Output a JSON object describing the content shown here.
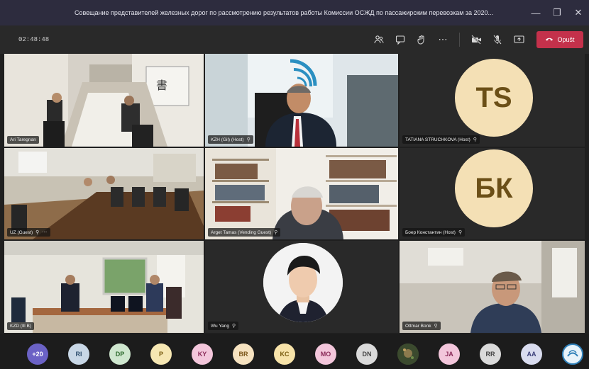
{
  "window": {
    "title": "Совещание представителей железных дорог по рассмотрению результатов работы Комиссии ОСЖД по пассажирским перевозкам за 2020..."
  },
  "toolbar": {
    "timer": "02:48:48",
    "leave_label": "Opušt",
    "icons": [
      "people-icon",
      "chat-icon",
      "raise-hand-icon",
      "more-icon",
      "camera-off-icon",
      "mic-off-icon",
      "share-screen-icon"
    ]
  },
  "tiles": [
    {
      "name": "Ari Taregnan"
    },
    {
      "name": "KZH (Gil) (Host)"
    },
    {
      "name": "TATIANA STRUCHKOVA (Host)",
      "initials": "TS"
    },
    {
      "name": "UZ (Guest)"
    },
    {
      "name": "Arget Tamas (Vending Guest)"
    },
    {
      "name": "Боер Константин (Host)",
      "initials": "БК"
    },
    {
      "name": "KZD (Ill B)"
    },
    {
      "name": "Wu Yang"
    },
    {
      "name": "Ottmar Bonk"
    }
  ],
  "participants": [
    {
      "initials": "+20",
      "bg": "#6b62c5",
      "fg": "#ffffff"
    },
    {
      "initials": "RI",
      "bg": "#c8d7e6",
      "fg": "#2f4f6f"
    },
    {
      "initials": "DP",
      "bg": "#cfe7cf",
      "fg": "#2e6b2e"
    },
    {
      "initials": "P",
      "bg": "#f6e7b3",
      "fg": "#7a5d10"
    },
    {
      "initials": "KY",
      "bg": "#f3c6db",
      "fg": "#8a2a58"
    },
    {
      "initials": "BR",
      "bg": "#f6e2c0",
      "fg": "#7a5418"
    },
    {
      "initials": "KC",
      "bg": "#f7e3a9",
      "fg": "#7a5d10"
    },
    {
      "initials": "MO",
      "bg": "#f3c6db",
      "fg": "#8a2a58"
    },
    {
      "initials": "DN",
      "bg": "#dadada",
      "fg": "#444444"
    },
    {
      "initials": "",
      "bg": "#3b4a2e",
      "fg": "#ffffff"
    },
    {
      "initials": "JA",
      "bg": "#f3c6db",
      "fg": "#8a2a58"
    },
    {
      "initials": "RR",
      "bg": "#dadada",
      "fg": "#444444"
    },
    {
      "initials": "AA",
      "bg": "#d9dcef",
      "fg": "#3b3f7a"
    },
    {
      "initials": "",
      "bg": "#2f7fb8",
      "fg": "#ffffff"
    }
  ],
  "colors": {
    "titlebar": "#2d2c3e",
    "toolbar": "#292929",
    "leave": "#c4314b",
    "initials_bg": "#f4e0b5",
    "initials_fg": "#6b4f17"
  }
}
